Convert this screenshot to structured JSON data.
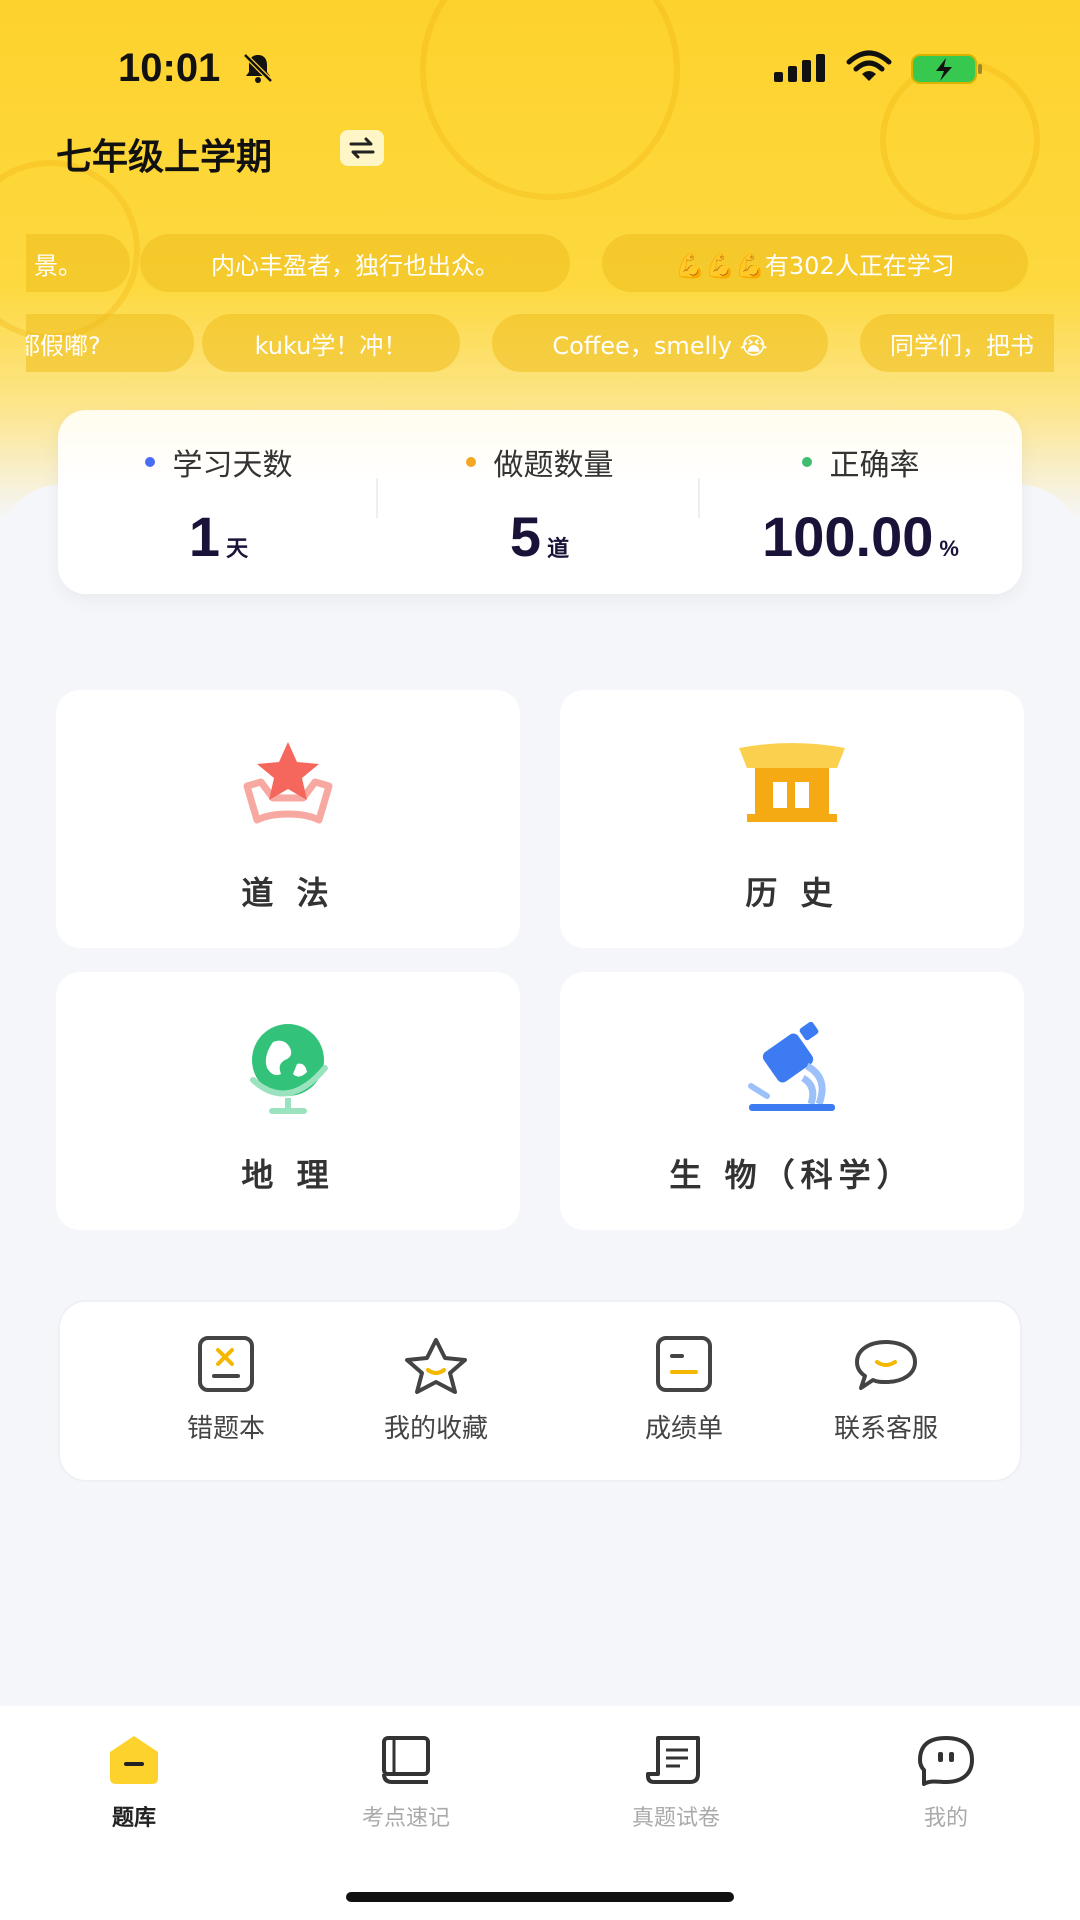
{
  "status_bar": {
    "time": "10:01"
  },
  "header": {
    "grade_title": "七年级上学期",
    "switch_icon": "swap-icon"
  },
  "marquee": {
    "row1": [
      "景。",
      "内心丰盈者，独行也出众。",
      "💪💪💪有302人正在学习"
    ],
    "row2": [
      "都假嘟?",
      "kuku学！冲！",
      "Coffee，smelly 😭",
      "同学们，把书"
    ]
  },
  "stats": [
    {
      "label": "学习天数",
      "value": "1",
      "unit": "天",
      "dot_color": "#4a6cf7"
    },
    {
      "label": "做题数量",
      "value": "5",
      "unit": "道",
      "dot_color": "#f5a623"
    },
    {
      "label": "正确率",
      "value": "100.00",
      "unit": "%",
      "dot_color": "#3dbd6d"
    }
  ],
  "subjects": [
    {
      "label": "道 法",
      "icon": "star-ribbon-icon"
    },
    {
      "label": "历 史",
      "icon": "pavilion-icon"
    },
    {
      "label": "地 理",
      "icon": "globe-icon"
    },
    {
      "label": "生 物（科学）",
      "icon": "microscope-icon"
    }
  ],
  "tools": [
    {
      "label": "错题本",
      "icon": "wrong-book-icon"
    },
    {
      "label": "我的收藏",
      "icon": "star-icon"
    },
    {
      "label": "成绩单",
      "icon": "report-icon"
    },
    {
      "label": "联系客服",
      "icon": "chat-bubble-icon"
    }
  ],
  "bottom_nav": [
    {
      "label": "题库",
      "icon": "home-icon",
      "active": true
    },
    {
      "label": "考点速记",
      "icon": "book-icon",
      "active": false
    },
    {
      "label": "真题试卷",
      "icon": "scroll-icon",
      "active": false
    },
    {
      "label": "我的",
      "icon": "profile-face-icon",
      "active": false
    }
  ],
  "colors": {
    "brand_yellow": "#fdd22d",
    "background": "#f5f6fa",
    "stat_value": "#1a1238"
  }
}
